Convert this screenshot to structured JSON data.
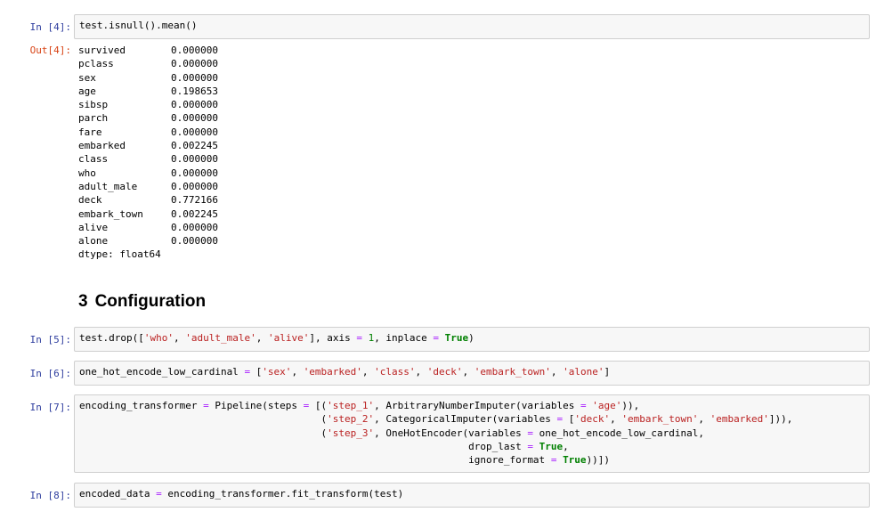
{
  "cells": {
    "c4": {
      "prompt": "In [4]:",
      "code": "test.isnull().mean()"
    },
    "out4": {
      "prompt": "Out[4]:",
      "rows": [
        {
          "name": "survived",
          "value": "0.000000"
        },
        {
          "name": "pclass",
          "value": "0.000000"
        },
        {
          "name": "sex",
          "value": "0.000000"
        },
        {
          "name": "age",
          "value": "0.198653"
        },
        {
          "name": "sibsp",
          "value": "0.000000"
        },
        {
          "name": "parch",
          "value": "0.000000"
        },
        {
          "name": "fare",
          "value": "0.000000"
        },
        {
          "name": "embarked",
          "value": "0.002245"
        },
        {
          "name": "class",
          "value": "0.000000"
        },
        {
          "name": "who",
          "value": "0.000000"
        },
        {
          "name": "adult_male",
          "value": "0.000000"
        },
        {
          "name": "deck",
          "value": "0.772166"
        },
        {
          "name": "embark_town",
          "value": "0.002245"
        },
        {
          "name": "alive",
          "value": "0.000000"
        },
        {
          "name": "alone",
          "value": "0.000000"
        }
      ],
      "dtype": "dtype: float64"
    },
    "heading": {
      "number": "3",
      "title": "Configuration"
    },
    "c5": {
      "prompt": "In [5]:",
      "code": "test.drop(['who', 'adult_male', 'alive'], axis = 1, inplace = True)"
    },
    "c6": {
      "prompt": "In [6]:",
      "code": "one_hot_encode_low_cardinal = ['sex', 'embarked', 'class', 'deck', 'embark_town', 'alone']"
    },
    "c7": {
      "prompt": "In [7]:",
      "lines": [
        "encoding_transformer = Pipeline(steps = [('step_1', ArbitraryNumberImputer(variables = 'age')),",
        "                                         ('step_2', CategoricalImputer(variables = ['deck', 'embark_town', 'embarked'])),",
        "                                         ('step_3', OneHotEncoder(variables = one_hot_encode_low_cardinal,",
        "                                                                  drop_last = True,",
        "                                                                  ignore_format = True))])"
      ]
    },
    "c8": {
      "prompt": "In [8]:",
      "code": "encoded_data = encoding_transformer.fit_transform(test)"
    }
  },
  "colors": {
    "prompt_in": "#303f9f",
    "prompt_out": "#d84315",
    "string": "#ba2121",
    "operator": "#aa22ff",
    "keyword": "#008000",
    "cell_bg": "#f7f7f7",
    "cell_border": "#cfcfcf"
  }
}
